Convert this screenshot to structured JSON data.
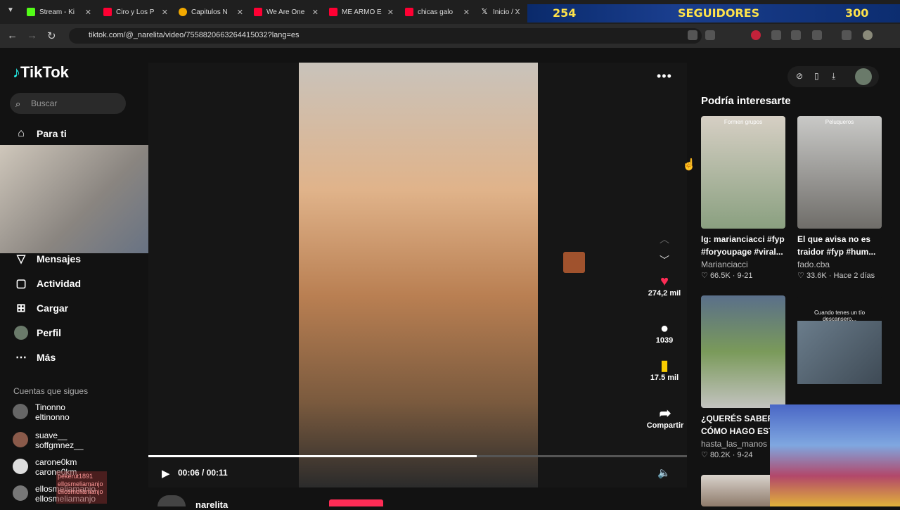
{
  "browser": {
    "tabs": [
      {
        "title": "Stream - Ki",
        "color": "#53fc18"
      },
      {
        "title": "Ciro y Los P",
        "color": "#ff0033"
      },
      {
        "title": "Capitulos N",
        "color": "#f2a900"
      },
      {
        "title": "We Are One",
        "color": "#ff0033"
      },
      {
        "title": "ME ARMO E",
        "color": "#ff0033"
      },
      {
        "title": "chicas galo",
        "color": "#ff0033"
      },
      {
        "title": "Inicio / X",
        "color": "#ffffff"
      }
    ],
    "url": "tiktok.com/@_narelita/video/7558820663264415032?lang=es",
    "banner": {
      "left": "254",
      "center": "SEGUIDORES",
      "right": "300"
    }
  },
  "sidebar": {
    "logo": "TikTok",
    "search_placeholder": "Buscar",
    "items": [
      {
        "label": "Para ti",
        "icon": "home-icon"
      },
      {
        "label": "Mensajes",
        "icon": "send-icon"
      },
      {
        "label": "Actividad",
        "icon": "activity-icon"
      },
      {
        "label": "Cargar",
        "icon": "upload-icon"
      },
      {
        "label": "Perfil",
        "icon": "profile-icon"
      },
      {
        "label": "Más",
        "icon": "more-icon"
      }
    ],
    "following_heading": "Cuentas que sigues",
    "following": [
      {
        "name": "Tinonno",
        "handle": "eltinonno"
      },
      {
        "name": "suave__",
        "handle": "soffgmnez__"
      },
      {
        "name": "carone0km",
        "handle": "carone0km"
      },
      {
        "name": "ellosmeliamanjo",
        "handle": "ellosmeliamanjo"
      }
    ]
  },
  "player": {
    "likes": "274,2 mil",
    "comments": "1039",
    "saves": "17.5 mil",
    "share": "Compartir",
    "time": "00:06 / 00:11",
    "progress": 0.61,
    "author": "narelita",
    "chat_overlay": [
      "pekerut1891",
      "ellosmeliamanjo",
      "ellosmeliamanjo"
    ]
  },
  "recommendations": {
    "heading": "Podría interesarte",
    "cards": [
      {
        "overlay": "Formen grupos",
        "caption": "Ig: marianciacci #fyp",
        "caption2": "#foryoupage #viral...",
        "author": "Marianciacci",
        "likes": "66.5K",
        "date": "9-21",
        "color": "#6f8a6a"
      },
      {
        "overlay": "Peluqueros",
        "caption": "El que avisa no es",
        "caption2": "traidor #fyp #hum...",
        "author": "fado.cba",
        "likes": "33.6K",
        "date": "Hace 2 días",
        "color": "#8c8a86"
      },
      {
        "overlay": "",
        "caption": "¿QUERÉS SABER",
        "caption2": "CÓMO HAGO EST",
        "author": "hasta_las_manos",
        "likes": "80.2K",
        "date": "9-24",
        "color": "#4f7a4a"
      },
      {
        "overlay": "Cuando tenes un tío descansero...",
        "caption": "",
        "caption2": "",
        "author": "",
        "likes": "",
        "date": "",
        "color": "#2a2a2a"
      }
    ]
  }
}
